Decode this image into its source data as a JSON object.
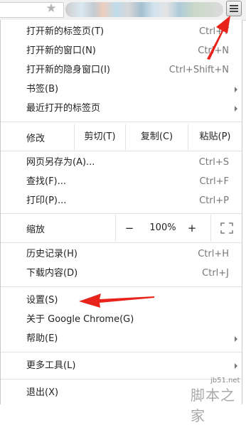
{
  "toolbar": {
    "star_icon": "star-icon",
    "menu_icon": "hamburger-menu-icon"
  },
  "menu": {
    "new_tab": {
      "label": "打开新的标签页(T)",
      "accel": "Ctrl+T"
    },
    "new_window": {
      "label": "打开新的窗口(N)",
      "accel": "Ctrl+N"
    },
    "new_incognito": {
      "label": "打开新的隐身窗口(I)",
      "accel": "Ctrl+Shift+N"
    },
    "bookmarks": {
      "label": "书签(B)"
    },
    "recent_tabs": {
      "label": "最近打开的标签页"
    },
    "edit": {
      "label": "修改",
      "cut": "剪切(T)",
      "copy": "复制(C)",
      "paste": "粘贴(P)"
    },
    "save_page": {
      "label": "网页另存为(A)...",
      "accel": "Ctrl+S"
    },
    "find": {
      "label": "查找(F)...",
      "accel": "Ctrl+F"
    },
    "print": {
      "label": "打印(P)...",
      "accel": "Ctrl+P"
    },
    "zoom": {
      "label": "缩放",
      "minus": "−",
      "level": "100%",
      "plus": "+"
    },
    "history": {
      "label": "历史记录(H)",
      "accel": "Ctrl+H"
    },
    "downloads": {
      "label": "下载内容(D)",
      "accel": "Ctrl+J"
    },
    "settings": {
      "label": "设置(S)"
    },
    "about": {
      "label": "关于 Google Chrome(G)"
    },
    "help": {
      "label": "帮助(E)"
    },
    "more_tools": {
      "label": "更多工具(L)"
    },
    "exit": {
      "label": "退出(X)"
    }
  },
  "watermark": {
    "url": "jb51.net",
    "brand": "脚本之家"
  },
  "colors": {
    "annotation_arrow": "#e8231b"
  }
}
